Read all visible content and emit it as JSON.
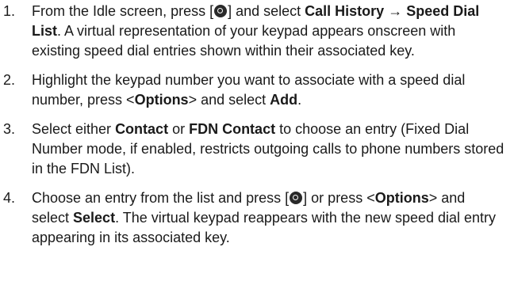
{
  "steps": [
    {
      "number": "1.",
      "parts": [
        {
          "t": "From the Idle screen, press [",
          "b": false
        },
        {
          "icon": "ok-key-icon"
        },
        {
          "t": "] and select ",
          "b": false
        },
        {
          "t": "Call History",
          "b": true
        },
        {
          "t": " → ",
          "b": false
        },
        {
          "t": "Speed Dial List",
          "b": true
        },
        {
          "t": ". A virtual representation of your keypad appears onscreen with existing speed dial entries shown within their associated key.",
          "b": false
        }
      ]
    },
    {
      "number": "2.",
      "parts": [
        {
          "t": "Highlight the keypad number you want to associate with a speed dial number, press <",
          "b": false
        },
        {
          "t": "Options",
          "b": true
        },
        {
          "t": "> and select ",
          "b": false
        },
        {
          "t": "Add",
          "b": true
        },
        {
          "t": ".",
          "b": false
        }
      ]
    },
    {
      "number": "3.",
      "parts": [
        {
          "t": "Select either ",
          "b": false
        },
        {
          "t": "Contact",
          "b": true
        },
        {
          "t": " or ",
          "b": false
        },
        {
          "t": "FDN Contact",
          "b": true
        },
        {
          "t": " to choose an entry (Fixed Dial Number mode, if enabled, restricts outgoing calls to phone numbers stored in the FDN List).",
          "b": false
        }
      ]
    },
    {
      "number": "4.",
      "parts": [
        {
          "t": "Choose an entry from the list and press [",
          "b": false
        },
        {
          "icon": "ok-key-icon"
        },
        {
          "t": "] or press <",
          "b": false
        },
        {
          "t": "Options",
          "b": true
        },
        {
          "t": "> and select ",
          "b": false
        },
        {
          "t": "Select",
          "b": true
        },
        {
          "t": ". The virtual keypad reappears with the new speed dial entry appearing in its associated key.",
          "b": false
        }
      ]
    }
  ]
}
